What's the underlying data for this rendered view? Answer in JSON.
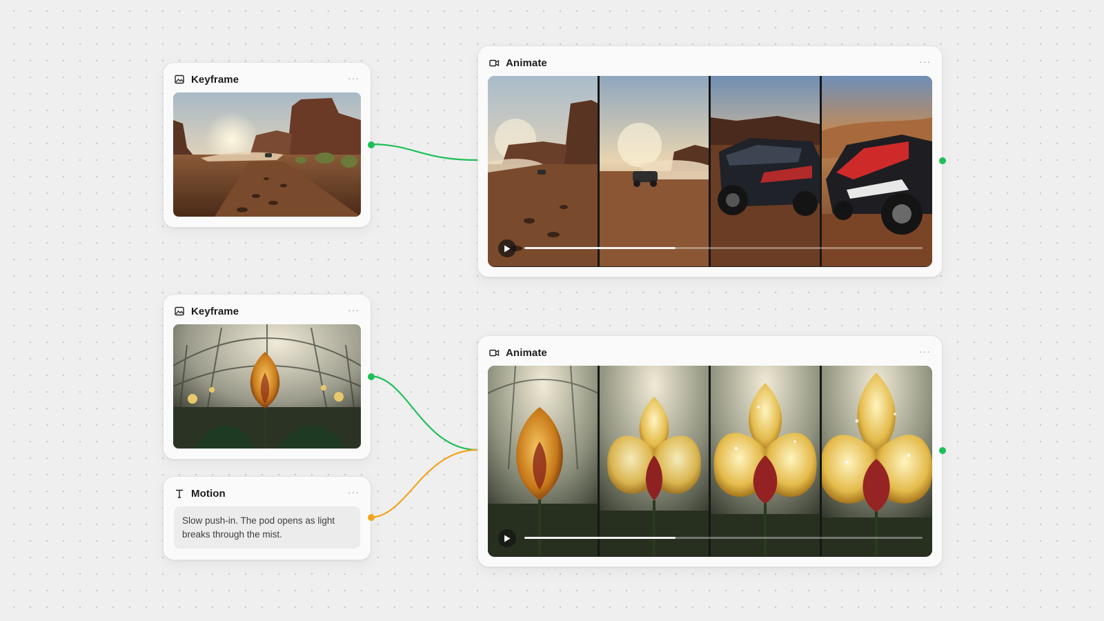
{
  "colors": {
    "canvas_bg": "#efefef",
    "port_image": "#1dbf57",
    "port_text": "#f3a41c",
    "wire_image": "#1dbf57",
    "wire_text": "#f3a41c"
  },
  "nodes": {
    "keyframe_1": {
      "title": "Keyframe",
      "icon": "image-icon",
      "menu": "···",
      "image": "desert rally: red sandstone buttes, dusty dirt track, car kicking up dust, low sun"
    },
    "animate_1": {
      "title": "Animate",
      "icon": "video-camera-icon",
      "menu": "···",
      "frames": [
        "desert track with car far away",
        "car approaching through dust",
        "rally car close-up",
        "red rally car close-up"
      ],
      "progress": 0.38
    },
    "keyframe_2": {
      "title": "Keyframe",
      "icon": "image-icon",
      "menu": "···",
      "image": "glass greenhouse dome with amber orchid bud in the center"
    },
    "motion": {
      "title": "Motion",
      "icon": "text-icon",
      "menu": "···",
      "text": "Slow push-in. The pod opens as light breaks through the mist."
    },
    "animate_2": {
      "title": "Animate",
      "icon": "video-camera-icon",
      "menu": "···",
      "frames": [
        "closed amber orchid bud",
        "orchid starting to open",
        "orchid open with dew drops",
        "fully open orchid"
      ],
      "progress": 0.38
    }
  }
}
